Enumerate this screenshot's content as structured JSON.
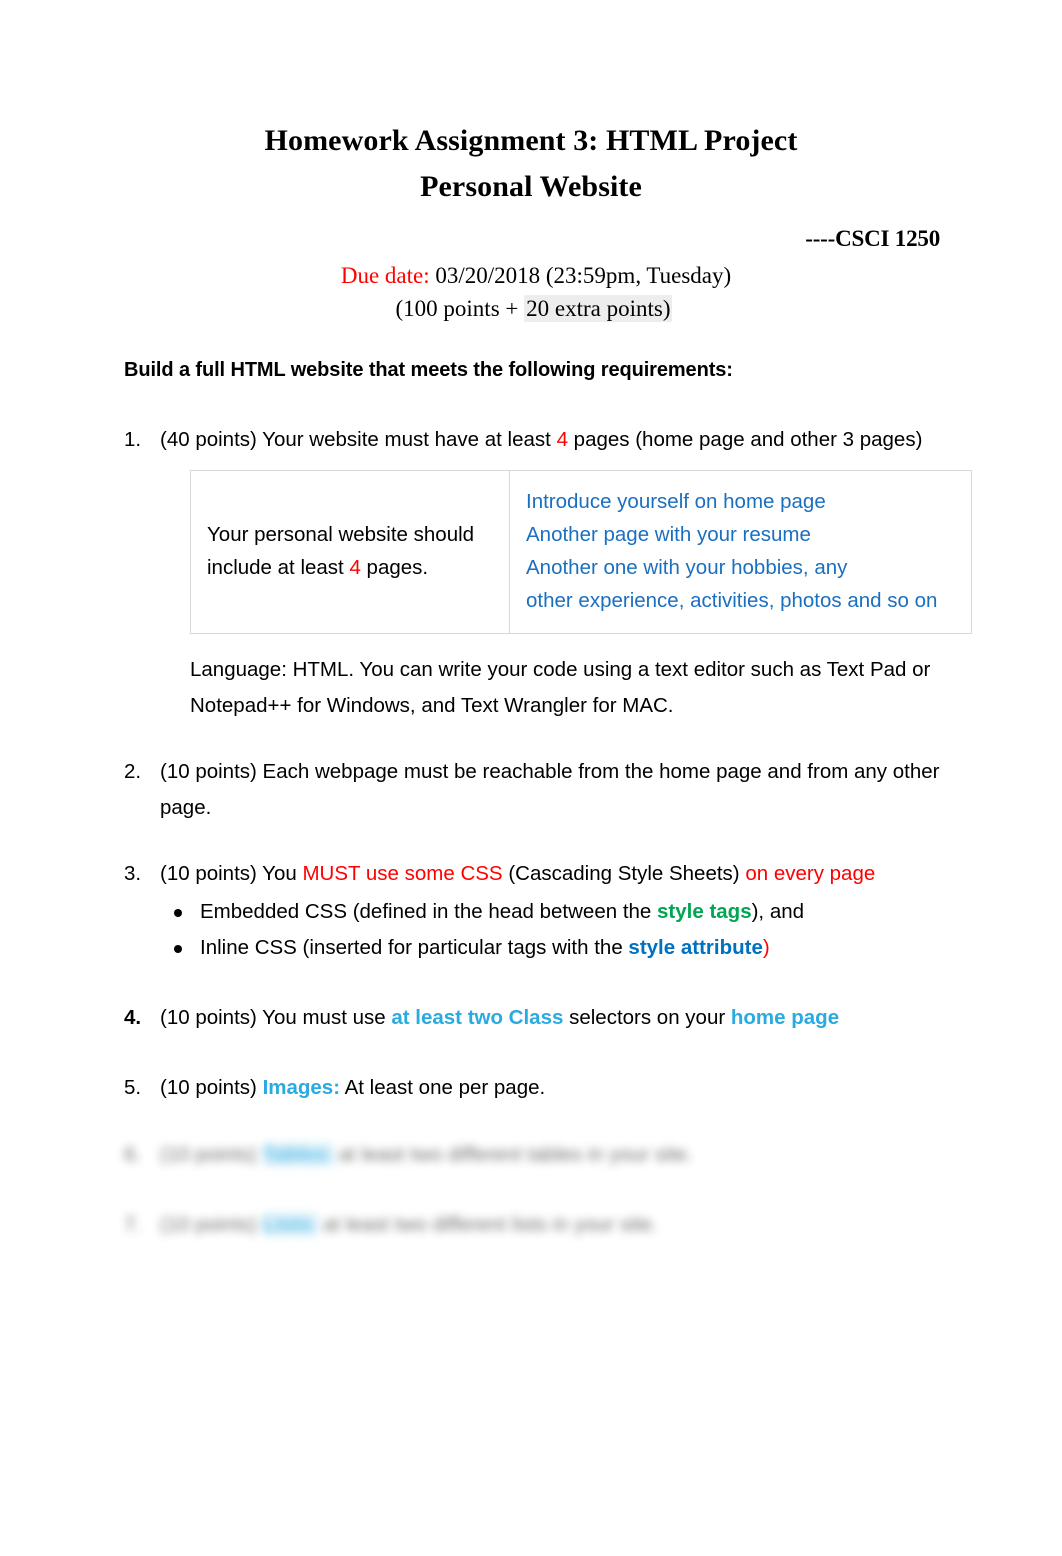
{
  "document": {
    "title_line1": "Homework Assignment 3: HTML Project",
    "title_line2": "Personal Website",
    "course": "----CSCI 1250",
    "due_label": "Due date:",
    "due_value": " 03/20/2018 (23:59pm, Tuesday)",
    "points_prefix": "(100 points + ",
    "points_shaded": "20 extra points)",
    "lede": "Build a full HTML website that meets the following requirements:"
  },
  "requirements": [
    {
      "num": "1.",
      "bold_num": false,
      "text_a": "(40 points) Your website must have at least ",
      "accent": "4",
      "text_b": " pages (home page and other 3 pages)"
    },
    {
      "num": "2.",
      "bold_num": false,
      "text_a": "(10 points) Each webpage must be reachable from the home page and from any other page."
    },
    {
      "num": "3.",
      "bold_num": false,
      "text_a": "(10 points) You ",
      "red1": "MUST use some CSS",
      "text_b": " (Cascading Style Sheets) ",
      "red2": "on every page"
    },
    {
      "num": "4.",
      "bold_num": true,
      "text_a": " (10 points) You must use ",
      "cyan1": "at least two Class",
      "text_b": " selectors on your ",
      "cyan2": "home page"
    },
    {
      "num": "5.",
      "bold_num": false,
      "text_a": "(10 points)   ",
      "cyan1": "Images:",
      "text_b": " At least one per page."
    }
  ],
  "table": {
    "left_cell": {
      "text_a": "Your personal website should include at least ",
      "accent": "4",
      "text_b": " pages."
    },
    "right_cell_lines": [
      "Introduce yourself on home page",
      "Another page with your resume",
      "Another one with your hobbies, any",
      "other experience, activities, photos and so on"
    ]
  },
  "language_note": "Language: HTML. You can write your code using a text editor such as Text Pad or Notepad++ for Windows, and Text Wrangler for MAC.",
  "css_bullets": [
    {
      "text_a": "Embedded CSS (defined in the head between the ",
      "highlight": "style tags",
      "highlight_color": "green",
      "text_b": "), and"
    },
    {
      "text_a": "Inline CSS (inserted for particular tags with the ",
      "highlight": "style attribute",
      "highlight_color": "blue",
      "text_b": ")",
      "text_b_color": "red"
    }
  ],
  "redacted_items": [
    {
      "num": "6.",
      "text_a": "(10 points) ",
      "tag": "Tables:",
      "text_b": " at least two different tables in your site."
    },
    {
      "num": "7.",
      "text_a": "(10 points) ",
      "tag": "Lists:",
      "text_b": " at least two different lists in your site."
    }
  ],
  "colors": {
    "accent_red": "#FF0000",
    "link_blue": "#0070C0",
    "table_blue": "#1B6FC0",
    "cyan": "#29ABE2",
    "green": "#00A651",
    "table_border": "#D8D8D8",
    "highlight_gray": "#ECECEC"
  }
}
